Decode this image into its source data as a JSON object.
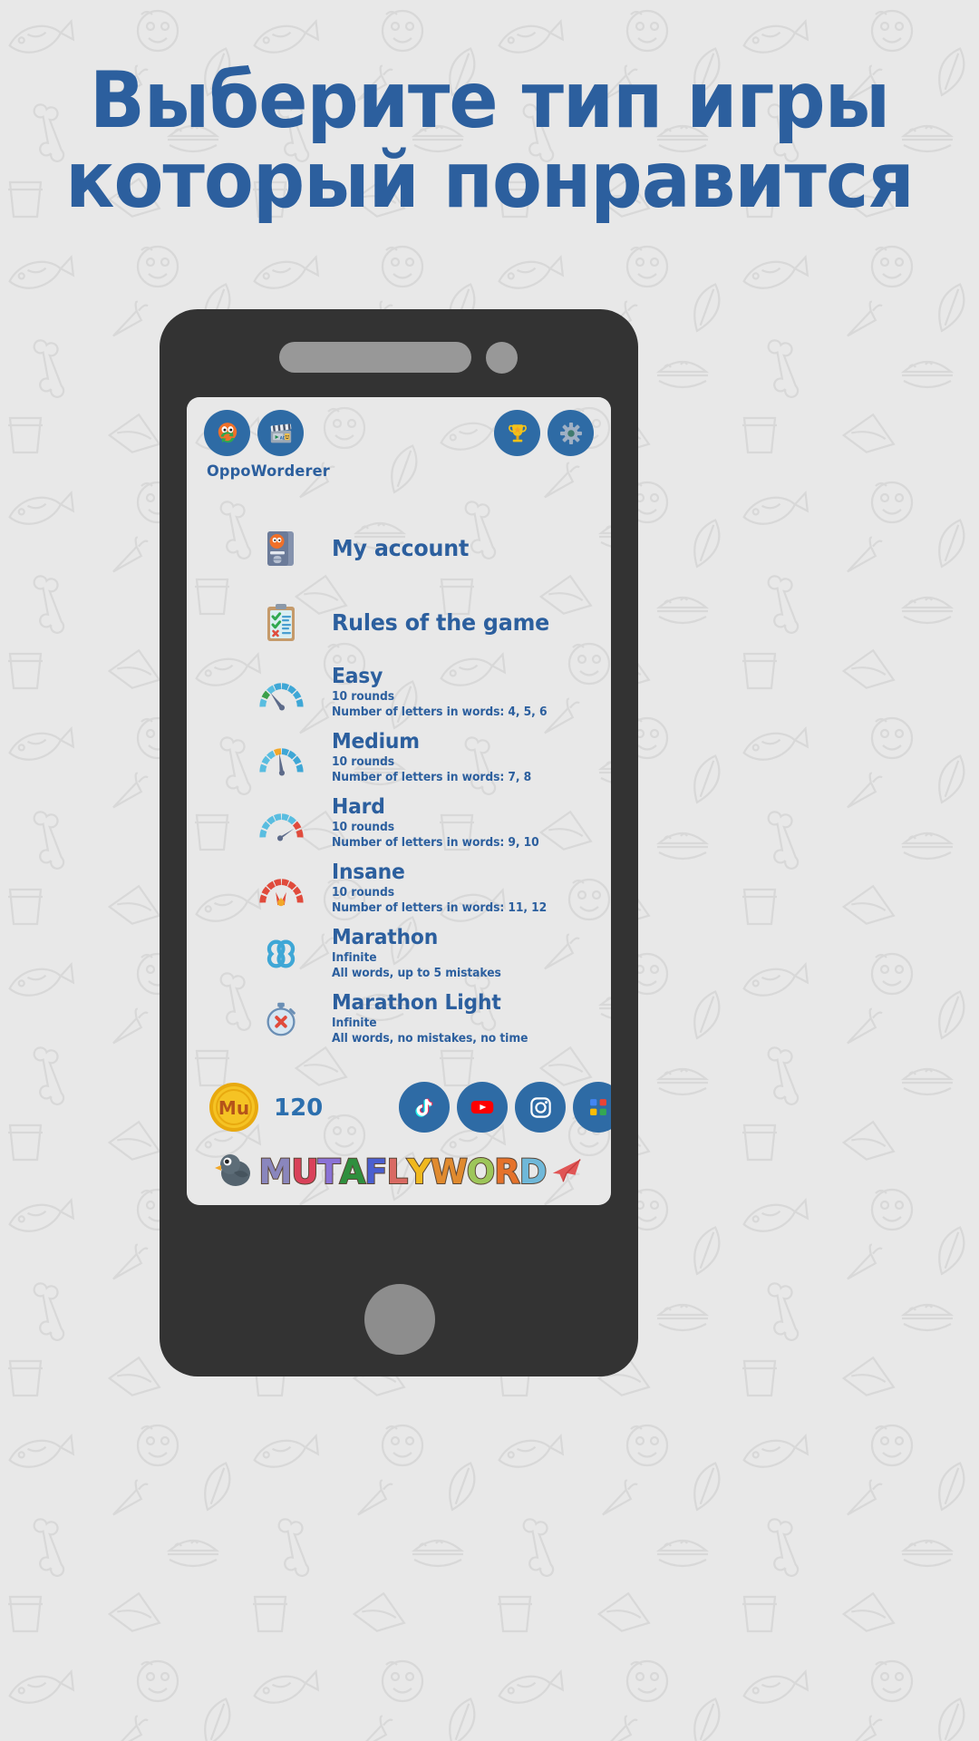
{
  "headline": {
    "line1": "Выберите тип игры",
    "line2": "который понравится",
    "color": "#2c5f9e"
  },
  "colors": {
    "background": "#e8e8e8",
    "phone_body": "#333333",
    "accent_blue": "#2e6ba5",
    "text_blue": "#2c5f9e",
    "coin_gold": "#f0b81e"
  },
  "app": {
    "name": "OppoWorderer",
    "header_buttons": [
      {
        "name": "avatar-button",
        "icon": "avatar-refresh-icon"
      },
      {
        "name": "watch-ad-button",
        "icon": "clapperboard-ad-icon"
      },
      {
        "name": "achievements-button",
        "icon": "trophy-icon"
      },
      {
        "name": "settings-button",
        "icon": "gear-icon"
      }
    ],
    "menu": [
      {
        "id": "my-account",
        "icon": "passport-icon",
        "title": "My account",
        "lines": []
      },
      {
        "id": "rules-of-the-game",
        "icon": "clipboard-checklist-icon",
        "title": "Rules of the game",
        "lines": []
      },
      {
        "id": "easy",
        "icon": "gauge-easy-icon",
        "title": "Easy",
        "lines": [
          "10 rounds",
          "Number of letters in words: 4, 5, 6"
        ]
      },
      {
        "id": "medium",
        "icon": "gauge-medium-icon",
        "title": "Medium",
        "lines": [
          "10 rounds",
          "Number of letters in words: 7, 8"
        ]
      },
      {
        "id": "hard",
        "icon": "gauge-hard-icon",
        "title": "Hard",
        "lines": [
          "10 rounds",
          "Number of letters in words: 9, 10"
        ]
      },
      {
        "id": "insane",
        "icon": "gauge-insane-icon",
        "title": "Insane",
        "lines": [
          "10 rounds",
          "Number of letters in words: 11, 12"
        ]
      },
      {
        "id": "marathon",
        "icon": "infinity-icon",
        "title": "Marathon",
        "lines": [
          "Infinite",
          "All words, up to 5 mistakes"
        ]
      },
      {
        "id": "marathon-light",
        "icon": "stopwatch-cross-icon",
        "title": "Marathon Light",
        "lines": [
          "Infinite",
          "All words, no mistakes, no time"
        ]
      }
    ],
    "coin": {
      "label": "Mu",
      "count": "120"
    },
    "social": [
      {
        "name": "tiktok-button",
        "icon": "tiktok-icon"
      },
      {
        "name": "youtube-button",
        "icon": "youtube-icon"
      },
      {
        "name": "instagram-button",
        "icon": "instagram-icon"
      },
      {
        "name": "more-apps-button",
        "icon": "apps-grid-icon"
      }
    ],
    "brand": {
      "text": "MUTAFLYWORD",
      "letter_colors": [
        "#8a86bd",
        "#d9425a",
        "#8a72d6",
        "#2f8f3e",
        "#4a5fd0",
        "#d96a63",
        "#f0b81e",
        "#e08a2e",
        "#9dc65a",
        "#e5722b",
        "#6fb8d9",
        "#d14f7a"
      ],
      "left_icon": "pigeon-icon",
      "right_icon": "plane-icon"
    }
  }
}
